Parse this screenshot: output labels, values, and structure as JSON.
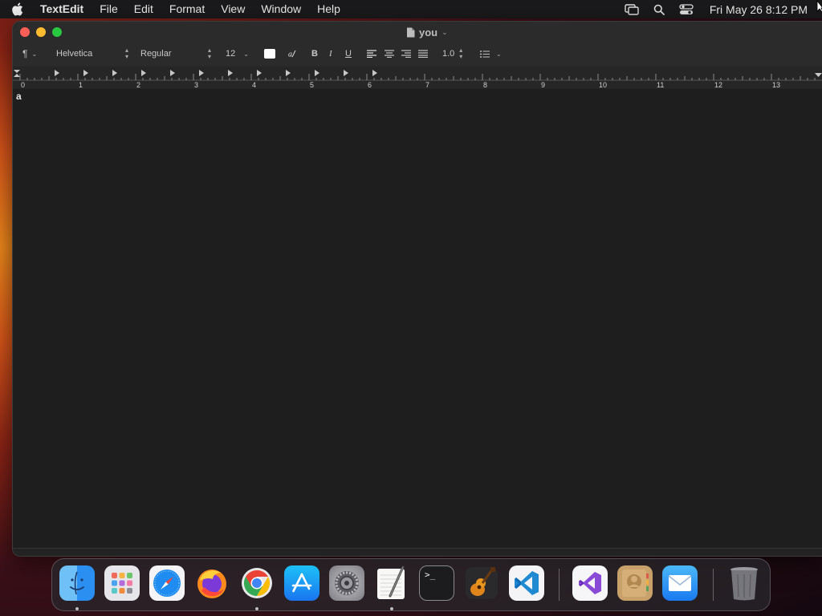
{
  "menubar": {
    "app_name": "TextEdit",
    "items": [
      "File",
      "Edit",
      "Format",
      "View",
      "Window",
      "Help"
    ],
    "clock": "Fri May 26  8:12 PM",
    "status_icons": [
      "screen-mirroring-icon",
      "search-icon",
      "control-center-icon"
    ]
  },
  "window": {
    "title": "you",
    "traffic_lights": {
      "close": "#ff5f57",
      "minimize": "#febc2e",
      "zoom": "#28c840"
    }
  },
  "toolbar": {
    "paragraph_symbol": "¶",
    "font_family": "Helvetica",
    "font_style": "Regular",
    "font_size": "12",
    "bold_label": "B",
    "italic_label": "I",
    "underline_label": "U",
    "line_spacing": "1.0"
  },
  "ruler": {
    "numbers": [
      "0",
      "1",
      "2",
      "3",
      "4",
      "5",
      "6",
      "7",
      "8",
      "9",
      "10",
      "11",
      "12",
      "13"
    ]
  },
  "document": {
    "text": "a"
  },
  "dock": {
    "apps": [
      {
        "name": "Finder",
        "icon": "finder-icon",
        "running": true
      },
      {
        "name": "Launchpad",
        "icon": "launchpad-icon",
        "running": false
      },
      {
        "name": "Safari",
        "icon": "safari-icon",
        "running": false
      },
      {
        "name": "Firefox",
        "icon": "firefox-icon",
        "running": false
      },
      {
        "name": "Google Chrome",
        "icon": "chrome-icon",
        "running": true
      },
      {
        "name": "App Store",
        "icon": "app-store-icon",
        "running": false
      },
      {
        "name": "System Settings",
        "icon": "system-settings-icon",
        "running": false
      },
      {
        "name": "TextEdit",
        "icon": "textedit-icon",
        "running": true
      },
      {
        "name": "Terminal",
        "icon": "terminal-icon",
        "running": false
      },
      {
        "name": "GarageBand",
        "icon": "garageband-icon",
        "running": false
      },
      {
        "name": "Visual Studio Code",
        "icon": "vscode-icon",
        "running": false
      },
      {
        "name": "Visual Studio",
        "icon": "visual-studio-icon",
        "running": false
      },
      {
        "name": "Contacts",
        "icon": "contacts-icon",
        "running": false
      },
      {
        "name": "Mail",
        "icon": "mail-icon",
        "running": false
      },
      {
        "name": "Trash",
        "icon": "trash-icon",
        "running": false
      }
    ],
    "terminal_prompt": ">_"
  }
}
